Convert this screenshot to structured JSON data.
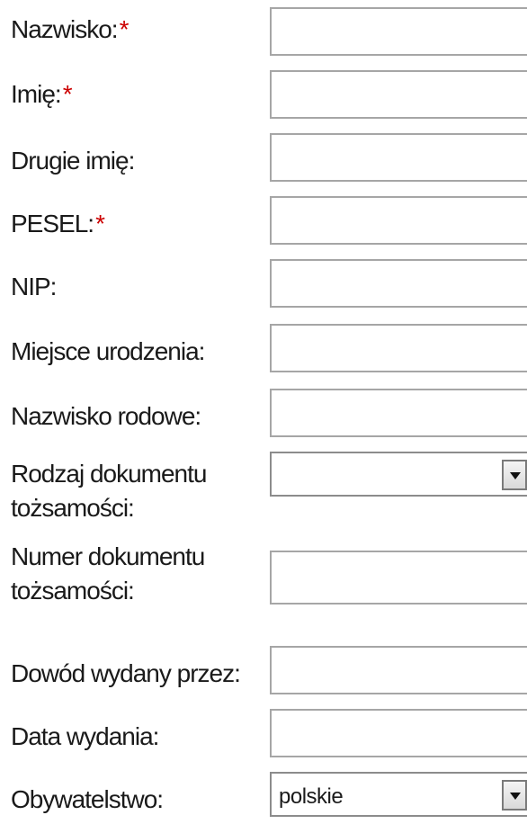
{
  "required_mark": "*",
  "required_color": "#cc0000",
  "fields": {
    "nazwisko": {
      "label": "Nazwisko:",
      "required": true,
      "value": ""
    },
    "imie": {
      "label": "Imię:",
      "required": true,
      "value": ""
    },
    "drugie_imie": {
      "label": "Drugie imię:",
      "required": false,
      "value": ""
    },
    "pesel": {
      "label": "PESEL:",
      "required": true,
      "value": ""
    },
    "nip": {
      "label": "NIP:",
      "required": false,
      "value": ""
    },
    "miejsce_urodzenia": {
      "label": "Miejsce urodzenia:",
      "required": false,
      "value": ""
    },
    "nazwisko_rodowe": {
      "label": "Nazwisko rodowe:",
      "required": false,
      "value": ""
    },
    "rodzaj_dokumentu": {
      "label_line1": "Rodzaj dokumentu",
      "label_line2": "tożsamości:",
      "required": false,
      "selected": ""
    },
    "numer_dokumentu": {
      "label_line1": "Numer dokumentu",
      "label_line2": "tożsamości:",
      "required": false,
      "value": ""
    },
    "dowod_wydany_przez": {
      "label": "Dowód wydany przez:",
      "required": false,
      "value": ""
    },
    "data_wydania": {
      "label": "Data wydania:",
      "required": false,
      "value": ""
    },
    "obywatelstwo": {
      "label": "Obywatelstwo:",
      "required": false,
      "selected": "polskie"
    }
  },
  "icons": {
    "select_arrow": "triangle-down-icon"
  }
}
